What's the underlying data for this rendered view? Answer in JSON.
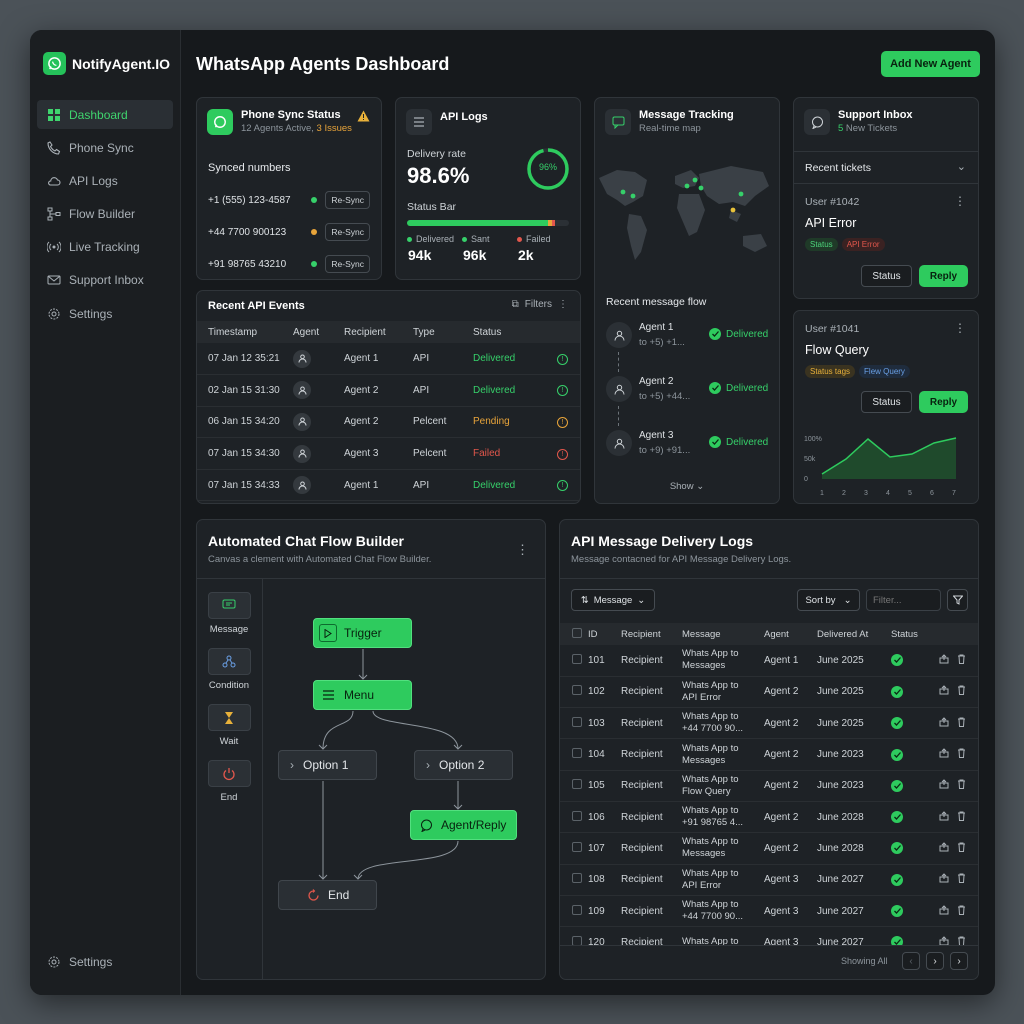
{
  "brand": {
    "name": "NotifyAgent.IO"
  },
  "sidebar": {
    "items": [
      {
        "label": "Dashboard",
        "icon": "grid-icon",
        "active": true
      },
      {
        "label": "Phone Sync",
        "icon": "phone-icon"
      },
      {
        "label": "API Logs",
        "icon": "cloud-icon"
      },
      {
        "label": "Flow Builder",
        "icon": "flow-icon"
      },
      {
        "label": "Live Tracking",
        "icon": "broadcast-icon"
      },
      {
        "label": "Support Inbox",
        "icon": "mail-icon"
      },
      {
        "label": "Settings",
        "icon": "gear-icon"
      }
    ],
    "bottom_label": "Settings"
  },
  "header": {
    "title": "WhatsApp Agents Dashboard",
    "add_button": "Add New Agent"
  },
  "phone_sync": {
    "title": "Phone Sync Status",
    "sub_a": "12 Agents Active, ",
    "sub_b": "3 Issues",
    "section": "Synced numbers",
    "numbers": [
      {
        "number": "+1 (555) 123-4587",
        "status_color": "#36d06a",
        "action": "Re-Sync"
      },
      {
        "number": "+44 7700 900123",
        "status_color": "#e8a43a",
        "action": "Re-Sync"
      },
      {
        "number": "+91 98765 43210",
        "status_color": "#36d06a",
        "action": "Re-Sync"
      }
    ]
  },
  "api_logs": {
    "title": "API Logs",
    "delivery_label": "Delivery rate",
    "delivery_value": "98.6%",
    "ring_label": "96%",
    "ring_fraction": 0.96,
    "status_bar_label": "Status Bar",
    "legend": [
      {
        "label": "Delivered",
        "value": "94k",
        "color": "#36d06a"
      },
      {
        "label": "Sant",
        "value": "96k",
        "color": "#36d06a"
      },
      {
        "label": "Failed",
        "value": "2k",
        "color": "#e2574c"
      }
    ]
  },
  "message_tracking": {
    "title": "Message Tracking",
    "sub": "Real-time map",
    "flow_title": "Recent message flow",
    "flow": [
      {
        "agent": "Agent 1",
        "to": "to +5) +1...",
        "status": "Delivered"
      },
      {
        "agent": "Agent 2",
        "to": "to +5) +44...",
        "status": "Delivered"
      },
      {
        "agent": "Agent 3",
        "to": "to +9) +91...",
        "status": "Delivered"
      }
    ],
    "show": "Show"
  },
  "support_inbox": {
    "title": "Support Inbox",
    "sub_count": "5",
    "sub_text": " New Tickets",
    "recent": "Recent tickets",
    "tickets": [
      {
        "user": "User #1042",
        "title": "API Error",
        "tags": [
          "Status",
          "API Error"
        ],
        "status_btn": "Status",
        "reply_btn": "Reply"
      },
      {
        "user": "User #1041",
        "title": "Flow Query",
        "tags": [
          "Status tags",
          "Flew Query"
        ],
        "status_btn": "Status",
        "reply_btn": "Reply"
      }
    ],
    "mini_chart": {
      "y_ticks": [
        "100%",
        "50k",
        "0"
      ],
      "x_ticks": [
        "1",
        "2",
        "3",
        "4",
        "5",
        "6",
        "7"
      ]
    }
  },
  "recent_events": {
    "title": "Recent API Events",
    "filters": "Filters",
    "columns": [
      "Timestamp",
      "Agent",
      "Recipient",
      "Type",
      "Status"
    ],
    "rows": [
      {
        "ts": "07 Jan 12 35:21",
        "recipient": "Agent 1",
        "type": "API",
        "status": "Delivered",
        "color": "#36d06a"
      },
      {
        "ts": "02 Jan 15 31:30",
        "recipient": "Agent 2",
        "type": "API",
        "status": "Delivered",
        "color": "#36d06a"
      },
      {
        "ts": "06 Jan 15 34:20",
        "recipient": "Agent 2",
        "type": "Pelcent",
        "status": "Pending",
        "color": "#e8a43a"
      },
      {
        "ts": "07 Jan 15 34:30",
        "recipient": "Agent 3",
        "type": "Pelcent",
        "status": "Failed",
        "color": "#e2574c"
      },
      {
        "ts": "07 Jan 15 34:33",
        "recipient": "Agent 1",
        "type": "API",
        "status": "Delivered",
        "color": "#36d06a"
      }
    ]
  },
  "flow_builder": {
    "title": "Automated Chat Flow Builder",
    "sub": "Canvas a clement with Automated Chat Flow Builder.",
    "tools": [
      "Message",
      "Condition",
      "Wait",
      "End"
    ],
    "nodes": {
      "trigger": "Trigger",
      "menu": "Menu",
      "option1": "Option 1",
      "option2": "Option 2",
      "agent_reply": "Agent/Reply",
      "end": "End"
    }
  },
  "delivery_logs": {
    "title": "API Message Delivery Logs",
    "sub": "Message contacned for API Message Delivery Logs.",
    "message_select": "Message",
    "sort": "Sort by",
    "filter_placeholder": "Filter...",
    "columns": [
      "ID",
      "Recipient",
      "Message",
      "Agent",
      "Delivered At",
      "Status"
    ],
    "rows": [
      {
        "id": "101",
        "recipient": "Recipient",
        "msg1": "Whats App to",
        "msg2": "Messages",
        "agent": "Agent 1",
        "date": "June 2025"
      },
      {
        "id": "102",
        "recipient": "Recipient",
        "msg1": "Whats App to",
        "msg2": "API Error",
        "agent": "Agent 2",
        "date": "June 2025"
      },
      {
        "id": "103",
        "recipient": "Recipient",
        "msg1": "Whats App to",
        "msg2": "+44 7700 90...",
        "agent": "Agent 2",
        "date": "June 2025"
      },
      {
        "id": "104",
        "recipient": "Recipient",
        "msg1": "Whats App to",
        "msg2": "Messages",
        "agent": "Agent 2",
        "date": "June 2023"
      },
      {
        "id": "105",
        "recipient": "Recipient",
        "msg1": "Whats App to",
        "msg2": "Flow Query",
        "agent": "Agent 2",
        "date": "June 2023"
      },
      {
        "id": "106",
        "recipient": "Recipient",
        "msg1": "Whats App to",
        "msg2": "+91 98765 4...",
        "agent": "Agent 2",
        "date": "June 2028"
      },
      {
        "id": "107",
        "recipient": "Recipient",
        "msg1": "Whats App to",
        "msg2": "Messages",
        "agent": "Agent 2",
        "date": "June 2028"
      },
      {
        "id": "108",
        "recipient": "Recipient",
        "msg1": "Whats App to",
        "msg2": "API Error",
        "agent": "Agent 3",
        "date": "June 2027"
      },
      {
        "id": "109",
        "recipient": "Recipient",
        "msg1": "Whats App to",
        "msg2": "+44 7700 90...",
        "agent": "Agent 3",
        "date": "June 2027"
      },
      {
        "id": "120",
        "recipient": "Recipient",
        "msg1": "Whats App to",
        "msg2": "",
        "agent": "Agent 3",
        "date": "June 2027"
      }
    ],
    "footer": "Showing All"
  }
}
